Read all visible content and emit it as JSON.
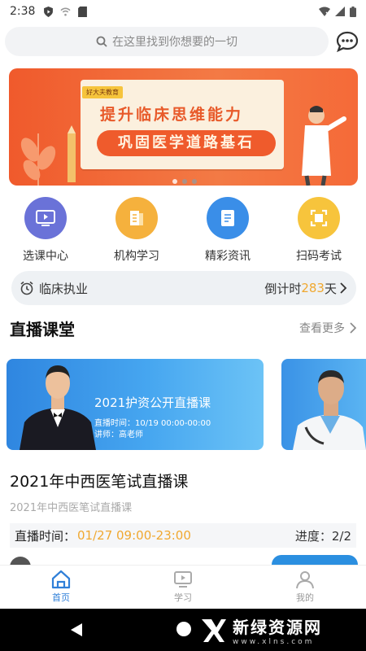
{
  "status_bar": {
    "time": "2:38"
  },
  "search": {
    "placeholder": "在这里找到你想要的一切"
  },
  "banner": {
    "tag": "好大夫教育",
    "line1": "提升临床思维能力",
    "line2": "巩固医学道路基石",
    "page_count": 3,
    "active_index": 0
  },
  "menu": [
    {
      "label": "选课中心",
      "icon": "play-video-icon",
      "color": "#6a72d8"
    },
    {
      "label": "机构学习",
      "icon": "book-icon",
      "color": "#f5b13d"
    },
    {
      "label": "精彩资讯",
      "icon": "news-icon",
      "color": "#3a8ee8"
    },
    {
      "label": "扫码考试",
      "icon": "scan-icon",
      "color": "#f7c43c"
    }
  ],
  "exam": {
    "name": "临床执业",
    "countdown_prefix": "倒计时",
    "days": "283",
    "suffix": "天"
  },
  "live": {
    "title": "直播课堂",
    "more": "查看更多",
    "card": {
      "title": "2021护资公开直播课",
      "time": "直播时间：10/19 00:00-00:00",
      "teacher": "讲师：高老师"
    },
    "course": {
      "title": "2021年中西医笔试直播课",
      "subtitle": "2021年中西医笔试直播课",
      "time_label": "直播时间：",
      "time_value": "01/27 09:00-23:00",
      "progress": "进度：2/2"
    }
  },
  "tabs": [
    {
      "label": "首页",
      "active": true
    },
    {
      "label": "学习",
      "active": false
    },
    {
      "label": "我的",
      "active": false
    }
  ],
  "watermark": {
    "name": "新绿资源网",
    "url": "www.xlns.com"
  },
  "colors": {
    "primary": "#2f7fd8",
    "accent": "#f0a830",
    "banner": "#f05a2c"
  }
}
